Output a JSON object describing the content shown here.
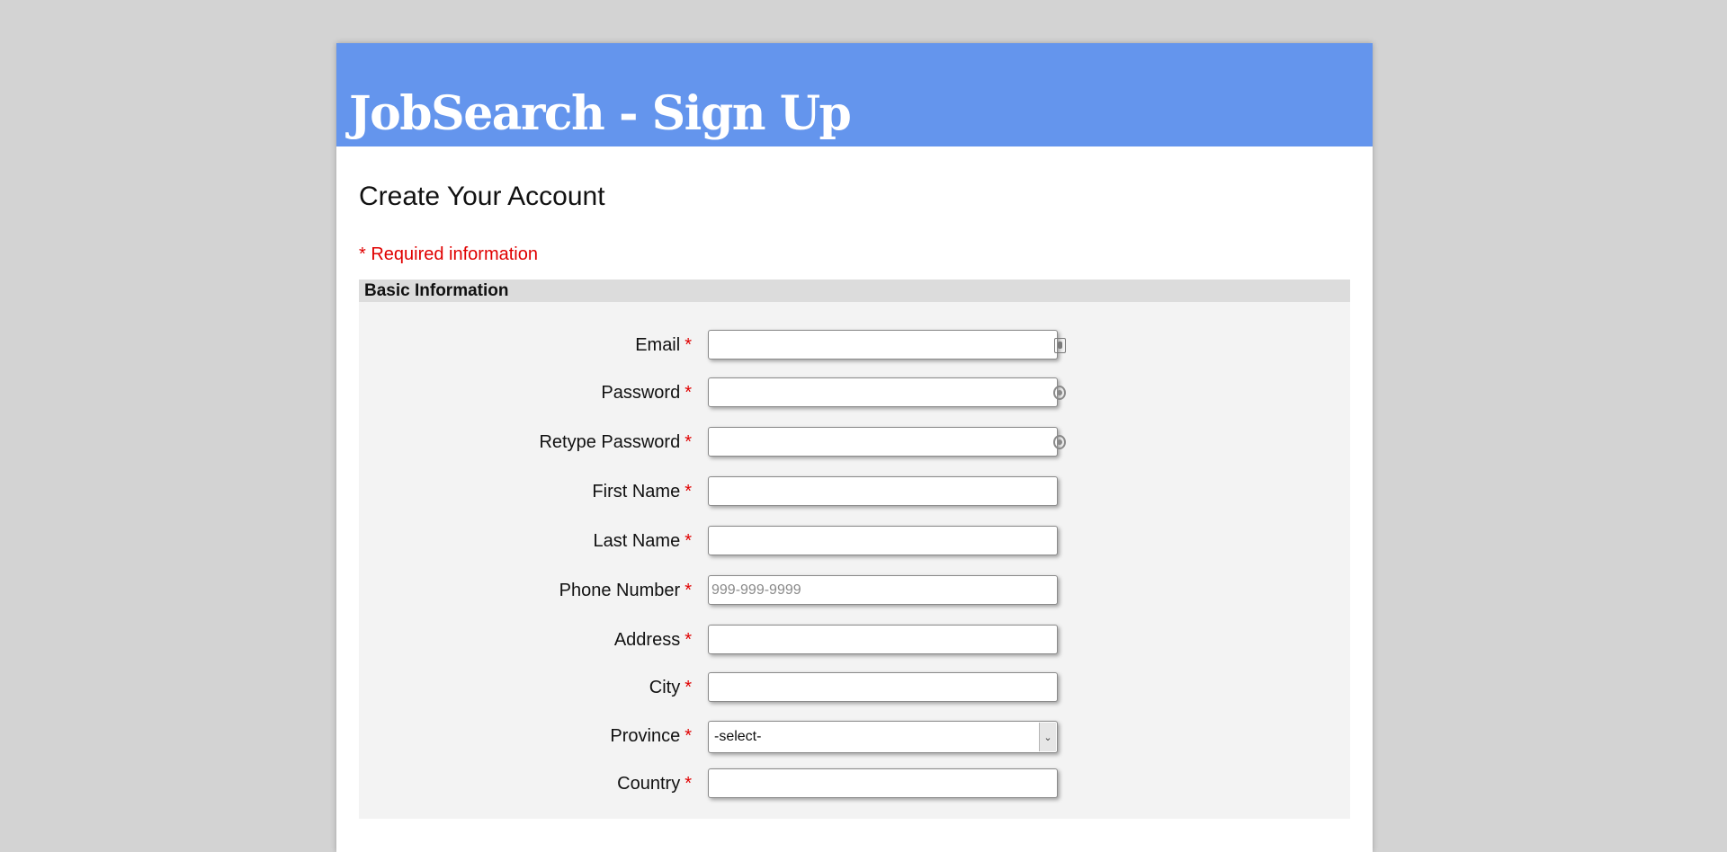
{
  "header": {
    "title": "JobSearch - Sign Up"
  },
  "page": {
    "title": "Create Your Account",
    "required_note": "* Required information",
    "section_title": "Basic Information"
  },
  "fields": {
    "email": {
      "label": "Email",
      "value": "",
      "icon": "contact-card-icon"
    },
    "password": {
      "label": "Password",
      "value": "",
      "icon": "password-key-icon"
    },
    "retype_password": {
      "label": "Retype Password",
      "value": "",
      "icon": "password-key-icon"
    },
    "first_name": {
      "label": "First Name",
      "value": ""
    },
    "last_name": {
      "label": "Last Name",
      "value": ""
    },
    "phone": {
      "label": "Phone Number",
      "value": "",
      "placeholder": "999-999-9999"
    },
    "address": {
      "label": "Address",
      "value": ""
    },
    "city": {
      "label": "City",
      "value": ""
    },
    "province": {
      "label": "Province",
      "selected": "-select-"
    },
    "country": {
      "label": "Country",
      "value": ""
    }
  },
  "required_marker": "*",
  "colors": {
    "background": "#d3d3d3",
    "header": "#6495ed",
    "required": "#e00000",
    "section_bg": "#f3f3f3",
    "section_header_bg": "#dcdcdc"
  }
}
